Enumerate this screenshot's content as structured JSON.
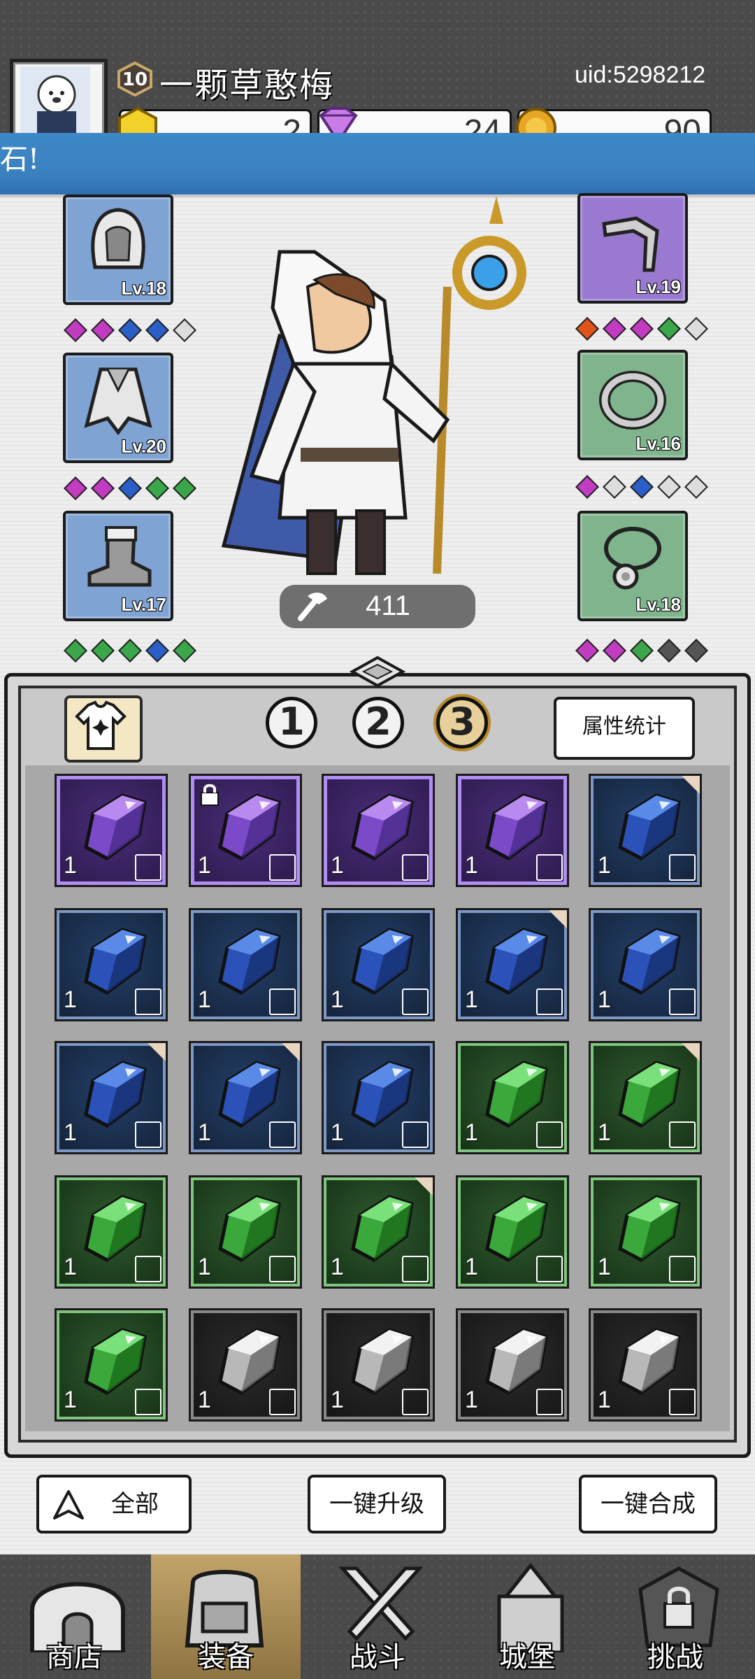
{
  "header": {
    "player_level": "10",
    "player_name": "一颗草憨梅",
    "uid": "uid:5298212",
    "resources": [
      {
        "name": "gold-gem-icon",
        "value": "2"
      },
      {
        "name": "diamond-icon",
        "value": "24"
      },
      {
        "name": "coin-icon",
        "value": "90"
      }
    ],
    "banner_text": "石!"
  },
  "equipment": {
    "left": [
      {
        "name": "hood",
        "level": "Lv.18",
        "rarity": "blue",
        "gems": [
          "#c23cc2",
          "#c23cc2",
          "#2a5ec8",
          "#2a5ec8",
          "#dddddd"
        ]
      },
      {
        "name": "armor",
        "level": "Lv.20",
        "rarity": "blue",
        "gems": [
          "#c23cc2",
          "#c23cc2",
          "#2a5ec8",
          "#3aa84a",
          "#3aa84a"
        ]
      },
      {
        "name": "boots",
        "level": "Lv.17",
        "rarity": "blue",
        "gems": [
          "#3aa84a",
          "#3aa84a",
          "#3aa84a",
          "#2a5ec8",
          "#3aa84a"
        ]
      }
    ],
    "right": [
      {
        "name": "weapon",
        "level": "Lv.19",
        "rarity": "purple",
        "gems": [
          "#e0541c",
          "#c23cc2",
          "#c23cc2",
          "#3aa84a",
          "#dddddd"
        ]
      },
      {
        "name": "ring",
        "level": "Lv.16",
        "rarity": "green",
        "gems": [
          "#c23cc2",
          "#dddddd",
          "#2a5ec8",
          "#dddddd",
          "#dddddd"
        ]
      },
      {
        "name": "necklace",
        "level": "Lv.18",
        "rarity": "green",
        "gems": [
          "#c23cc2",
          "#c23cc2",
          "#3aa84a",
          "#555555",
          "#555555"
        ]
      }
    ]
  },
  "hero": {
    "power": "411"
  },
  "inventory": {
    "pages": [
      "1",
      "2",
      "3"
    ],
    "active_page": "3",
    "stats_label": "属性统计",
    "items": [
      {
        "rarity": "purple",
        "qty": "1",
        "slot": "boots",
        "locked": false,
        "new": false
      },
      {
        "rarity": "purple",
        "qty": "1",
        "slot": "weapon",
        "locked": true,
        "new": false
      },
      {
        "rarity": "purple",
        "qty": "1",
        "slot": "hood",
        "locked": false,
        "new": false
      },
      {
        "rarity": "purple",
        "qty": "1",
        "slot": "necklace",
        "locked": false,
        "new": false
      },
      {
        "rarity": "blue",
        "qty": "1",
        "slot": "ring",
        "locked": false,
        "new": true
      },
      {
        "rarity": "blue",
        "qty": "1",
        "slot": "ring",
        "locked": false,
        "new": false
      },
      {
        "rarity": "blue",
        "qty": "1",
        "slot": "armor",
        "locked": false,
        "new": false
      },
      {
        "rarity": "blue",
        "qty": "1",
        "slot": "armor",
        "locked": false,
        "new": false
      },
      {
        "rarity": "blue",
        "qty": "1",
        "slot": "boots",
        "locked": false,
        "new": true
      },
      {
        "rarity": "blue",
        "qty": "1",
        "slot": "weapon",
        "locked": false,
        "new": false
      },
      {
        "rarity": "blue",
        "qty": "1",
        "slot": "necklace",
        "locked": false,
        "new": true
      },
      {
        "rarity": "blue",
        "qty": "1",
        "slot": "necklace",
        "locked": false,
        "new": true
      },
      {
        "rarity": "blue",
        "qty": "1",
        "slot": "necklace",
        "locked": false,
        "new": false
      },
      {
        "rarity": "green",
        "qty": "1",
        "slot": "ring",
        "locked": false,
        "new": false
      },
      {
        "rarity": "green",
        "qty": "1",
        "slot": "ring",
        "locked": false,
        "new": true
      },
      {
        "rarity": "green",
        "qty": "1",
        "slot": "armor",
        "locked": false,
        "new": false
      },
      {
        "rarity": "green",
        "qty": "1",
        "slot": "boots",
        "locked": false,
        "new": false
      },
      {
        "rarity": "green",
        "qty": "1",
        "slot": "weapon",
        "locked": false,
        "new": true
      },
      {
        "rarity": "green",
        "qty": "1",
        "slot": "weapon",
        "locked": false,
        "new": false
      },
      {
        "rarity": "green",
        "qty": "1",
        "slot": "weapon",
        "locked": false,
        "new": false
      },
      {
        "rarity": "green",
        "qty": "1",
        "slot": "necklace",
        "locked": false,
        "new": false
      },
      {
        "rarity": "grey",
        "qty": "1",
        "slot": "ring",
        "locked": false,
        "new": false
      },
      {
        "rarity": "grey",
        "qty": "1",
        "slot": "ring",
        "locked": false,
        "new": false
      },
      {
        "rarity": "grey",
        "qty": "1",
        "slot": "armor",
        "locked": false,
        "new": false
      },
      {
        "rarity": "grey",
        "qty": "1",
        "slot": "boots",
        "locked": false,
        "new": false
      }
    ]
  },
  "actions": {
    "filter_label": "全部",
    "upgrade_all_label": "一键升级",
    "merge_all_label": "一键合成"
  },
  "nav": [
    {
      "label": "商店",
      "icon": "shop-icon",
      "active": false
    },
    {
      "label": "装备",
      "icon": "backpack-icon",
      "active": true
    },
    {
      "label": "战斗",
      "icon": "swords-icon",
      "active": false
    },
    {
      "label": "城堡",
      "icon": "castle-icon",
      "active": false
    },
    {
      "label": "挑战",
      "icon": "locked-challenge-icon",
      "active": false
    }
  ]
}
